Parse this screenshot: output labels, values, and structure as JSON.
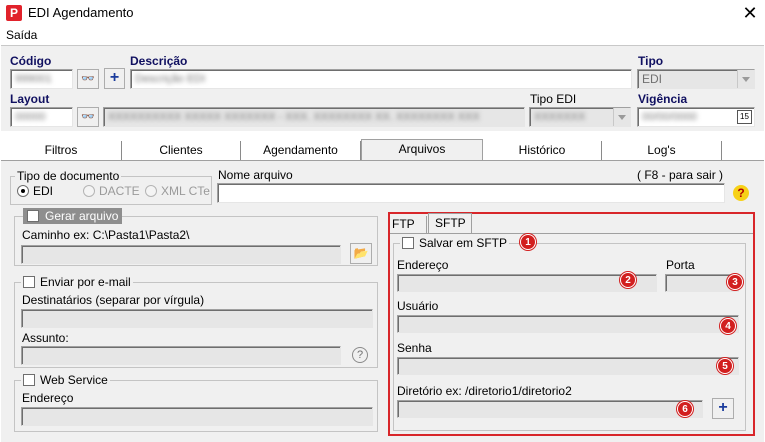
{
  "window": {
    "title": "EDI Agendamento",
    "close_glyph": "✕",
    "icon_letter": "P",
    "accent": "#e1222b"
  },
  "menu": {
    "items": [
      "Saída"
    ]
  },
  "header": {
    "codigo_label": "Código",
    "codigo_value": "999001",
    "descricao_label": "Descrição",
    "descricao_value": "Descrição EDI",
    "tipo_label": "Tipo",
    "tipo_value": "EDI",
    "layout_label": "Layout",
    "layout_value": "00000",
    "layout_desc_value": "XXXXXXXXXX XXXXX XXXXXXX - XXX. XXXXXXXX XX. XXXXXXXX XXX",
    "tipo_edi_label": "Tipo EDI",
    "tipo_edi_value": "XXXXXXX",
    "vigencia_label": "Vigência",
    "vigencia_value": "00/00/0000",
    "search_glyph": "👓",
    "add_glyph": "+",
    "calendar_glyph": "15"
  },
  "tabs": [
    "Filtros",
    "Clientes",
    "Agendamento",
    "Arquivos",
    "Histórico",
    "Log's"
  ],
  "selected_tab": "Arquivos",
  "arquivos": {
    "tipo_doc_label": "Tipo de documento",
    "tipo_doc_options": [
      "EDI",
      "DACTE",
      "XML CTe"
    ],
    "nome_arquivo_label": "Nome arquivo",
    "f8_hint": "( F8 - para sair )",
    "help_glyph": "?",
    "gerar_arquivo_label": "Gerar arquivo",
    "caminho_label": "Caminho ex: C:\\Pasta1\\Pasta2\\",
    "folder_glyph": "📂",
    "email_label": "Enviar por e-mail",
    "destinatarios_label": "Destinatários (separar por vírgula)",
    "assunto_label": "Assunto:",
    "question_glyph": "?",
    "webservice_label": "Web Service",
    "ws_endereco_label": "Endereço",
    "ftp_tabs": [
      "FTP",
      "SFTP"
    ],
    "salvar_sftp_label": "Salvar em SFTP",
    "endereco_label": "Endereço",
    "porta_label": "Porta",
    "usuario_label": "Usuário",
    "senha_label": "Senha",
    "diretorio_label": "Diretório ex: /diretorio1/diretorio2",
    "badges": [
      "1",
      "2",
      "3",
      "4",
      "5",
      "6"
    ],
    "badge_color": "#d21f1f",
    "highlight_color": "#d8262a"
  }
}
